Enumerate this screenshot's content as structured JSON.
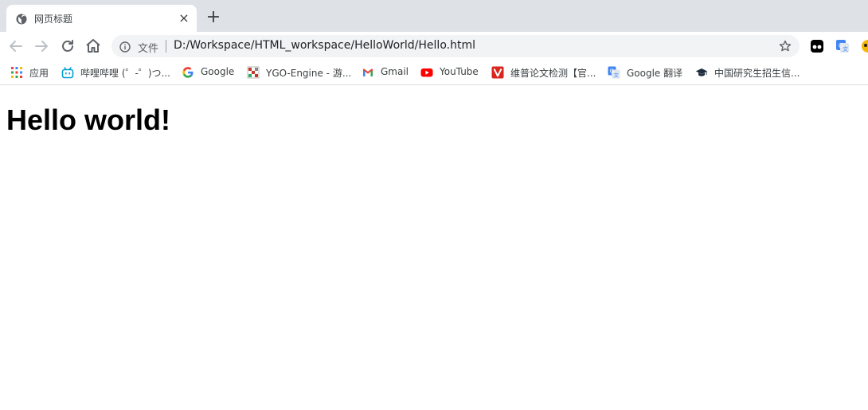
{
  "browser": {
    "tab": {
      "title": "网页标题",
      "close_glyph": "×",
      "favicon": "globe-icon"
    },
    "new_tab_glyph": "+",
    "toolbar": {
      "back_icon": "back-arrow-icon",
      "forward_icon": "forward-arrow-icon",
      "reload_icon": "reload-icon",
      "home_icon": "home-icon",
      "scheme_label": "文件",
      "url": "D:/Workspace/HTML_workspace/HelloWorld/Hello.html",
      "bookmark_icon": "star-icon",
      "extensions": [
        "tampermonkey-icon",
        "google-translate-icon",
        "extension-icon"
      ]
    },
    "bookmarks": [
      {
        "label": "应用",
        "icon": "apps-grid-icon"
      },
      {
        "label": "哔哩哔哩 (゜-゜)つ...",
        "icon": "bilibili-icon"
      },
      {
        "label": "Google",
        "icon": "google-icon"
      },
      {
        "label": "YGO-Engine - 游...",
        "icon": "ygo-engine-icon"
      },
      {
        "label": "Gmail",
        "icon": "gmail-icon"
      },
      {
        "label": "YouTube",
        "icon": "youtube-icon"
      },
      {
        "label": "维普论文检测【官...",
        "icon": "weipu-icon"
      },
      {
        "label": "Google 翻译",
        "icon": "google-translate-icon"
      },
      {
        "label": "中国研究生招生信...",
        "icon": "graduation-cap-icon"
      }
    ]
  },
  "page": {
    "heading": "Hello world!"
  },
  "colors": {
    "tabstrip_bg": "#dee1e6",
    "omnibox_bg": "#f1f3f4",
    "text": "#3c4043"
  }
}
